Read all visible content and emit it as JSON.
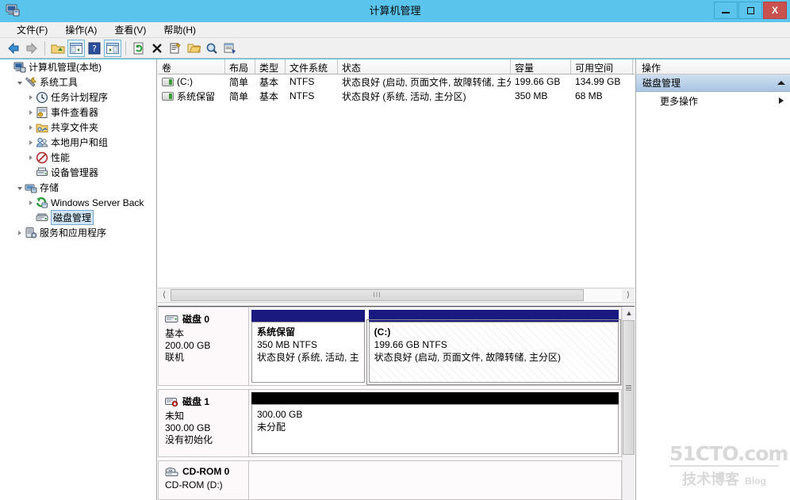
{
  "window": {
    "title": "计算机管理",
    "icon": "computer-management-icon",
    "minimize_label": "",
    "maximize_label": "",
    "close_label": "X"
  },
  "menu": {
    "items": [
      {
        "label": "文件(F)",
        "name": "menu-file"
      },
      {
        "label": "操作(A)",
        "name": "menu-action"
      },
      {
        "label": "查看(V)",
        "name": "menu-view"
      },
      {
        "label": "帮助(H)",
        "name": "menu-help"
      }
    ]
  },
  "toolbar": {
    "buttons": [
      {
        "name": "back-icon",
        "glyph": "back-arrow"
      },
      {
        "name": "forward-icon",
        "glyph": "forward-arrow"
      },
      {
        "name": "up-folder-icon",
        "glyph": "folder-up"
      },
      {
        "name": "show-hide-tree-icon",
        "glyph": "console-tree"
      },
      {
        "name": "help-icon",
        "glyph": "question"
      },
      {
        "name": "show-action-pane-icon",
        "glyph": "console-pane"
      },
      {
        "name": "refresh-icon",
        "glyph": "refresh"
      },
      {
        "name": "delete-icon",
        "glyph": "cross"
      },
      {
        "name": "properties-icon",
        "glyph": "properties"
      },
      {
        "name": "open-icon",
        "glyph": "open-folder"
      },
      {
        "name": "find-icon",
        "glyph": "magnifier"
      },
      {
        "name": "export-list-icon",
        "glyph": "export-list"
      }
    ]
  },
  "tree": {
    "items": [
      {
        "label": "计算机管理(本地)",
        "depth": 0,
        "twisty": "none",
        "icon": "computer-icon",
        "selected": false,
        "name": "tree-item-computer-management"
      },
      {
        "label": "系统工具",
        "depth": 1,
        "twisty": "open",
        "icon": "tools-icon",
        "selected": false,
        "name": "tree-item-system-tools"
      },
      {
        "label": "任务计划程序",
        "depth": 2,
        "twisty": "closed",
        "icon": "clock-icon",
        "selected": false,
        "name": "tree-item-task-scheduler"
      },
      {
        "label": "事件查看器",
        "depth": 2,
        "twisty": "closed",
        "icon": "event-viewer-icon",
        "selected": false,
        "name": "tree-item-event-viewer"
      },
      {
        "label": "共享文件夹",
        "depth": 2,
        "twisty": "closed",
        "icon": "shared-folder-icon",
        "selected": false,
        "name": "tree-item-shared-folders"
      },
      {
        "label": "本地用户和组",
        "depth": 2,
        "twisty": "closed",
        "icon": "users-icon",
        "selected": false,
        "name": "tree-item-local-users-groups"
      },
      {
        "label": "性能",
        "depth": 2,
        "twisty": "closed",
        "icon": "performance-icon",
        "selected": false,
        "name": "tree-item-performance"
      },
      {
        "label": "设备管理器",
        "depth": 2,
        "twisty": "none",
        "icon": "device-manager-icon",
        "selected": false,
        "name": "tree-item-device-manager"
      },
      {
        "label": "存储",
        "depth": 1,
        "twisty": "open",
        "icon": "storage-icon",
        "selected": false,
        "name": "tree-item-storage"
      },
      {
        "label": "Windows Server Back",
        "depth": 2,
        "twisty": "closed",
        "icon": "backup-icon",
        "selected": false,
        "name": "tree-item-windows-server-backup"
      },
      {
        "label": "磁盘管理",
        "depth": 2,
        "twisty": "none",
        "icon": "disk-management-icon",
        "selected": true,
        "name": "tree-item-disk-management"
      },
      {
        "label": "服务和应用程序",
        "depth": 1,
        "twisty": "closed",
        "icon": "services-icon",
        "selected": false,
        "name": "tree-item-services-and-applications"
      }
    ]
  },
  "volume_list": {
    "columns": [
      "卷",
      "布局",
      "类型",
      "文件系统",
      "状态",
      "容量",
      "可用空间"
    ],
    "rows": [
      {
        "volume": "(C:)",
        "layout": "简单",
        "type": "基本",
        "filesystem": "NTFS",
        "status": "状态良好 (启动, 页面文件, 故障转储, 主分区)",
        "capacity": "199.66 GB",
        "free": "134.99 GB"
      },
      {
        "volume": "系统保留",
        "layout": "简单",
        "type": "基本",
        "filesystem": "NTFS",
        "status": "状态良好 (系统, 活动, 主分区)",
        "capacity": "350 MB",
        "free": "68 MB"
      }
    ],
    "hscroll_grip": "III"
  },
  "disk_view": {
    "disks": [
      {
        "name": "磁盘 0",
        "icon": "disk-icon",
        "type": "基本",
        "size": "200.00 GB",
        "state": "联机",
        "partitions": [
          {
            "name": "系统保留",
            "size_fs": "350 MB NTFS",
            "status": "状态良好 (系统, 活动, 主",
            "cap_color": "#191980",
            "selected": false,
            "width_pct": 30
          },
          {
            "name": "(C:)",
            "size_fs": "199.66 GB NTFS",
            "status": "状态良好 (启动, 页面文件, 故障转储, 主分区)",
            "cap_color": "#191980",
            "selected": true,
            "width_pct": 70
          }
        ]
      },
      {
        "name": "磁盘 1",
        "icon": "disk-unknown-icon",
        "type": "未知",
        "size": "300.00 GB",
        "state": "没有初始化",
        "partitions": [
          {
            "name": "",
            "size_fs": "300.00 GB",
            "status": "未分配",
            "cap_color": "#000000",
            "selected": false,
            "width_pct": 100
          }
        ]
      },
      {
        "name": "CD-ROM 0",
        "icon": "cdrom-icon",
        "type": "CD-ROM (D:)",
        "size": "",
        "state": "",
        "partitions": []
      }
    ]
  },
  "actions": {
    "title": "操作",
    "group_label": "磁盘管理",
    "items": [
      {
        "label": "更多操作",
        "name": "action-more-actions",
        "has_submenu": true
      }
    ]
  },
  "watermark": {
    "top": "51CTO.com",
    "cn": "技术博客",
    "en": "Blog"
  },
  "colors": {
    "titlebar": "#5ac4ec",
    "close_button": "#c9524e",
    "partition_cap": "#191980",
    "unallocated_cap": "#000000",
    "actions_group": "#a9c5e2",
    "tree_selection": "#cfe4f5"
  }
}
